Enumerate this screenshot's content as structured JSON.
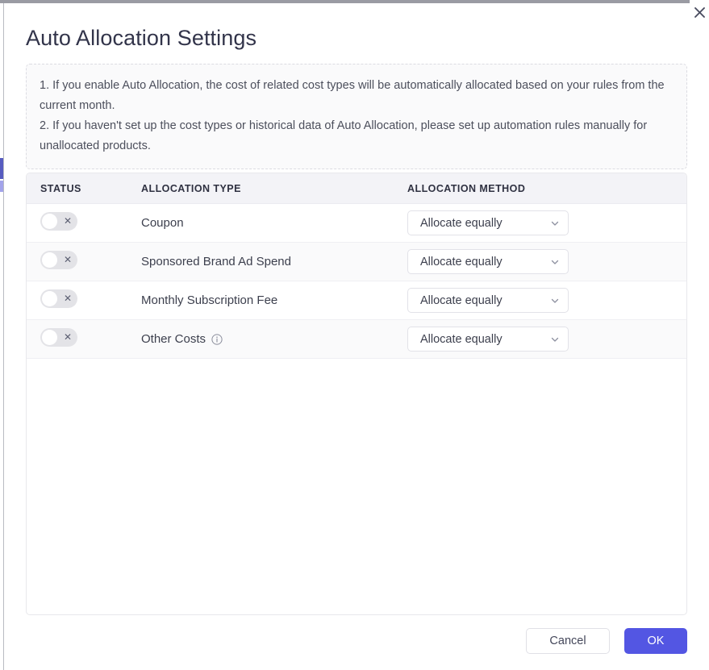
{
  "window": {
    "close_icon": "close-icon"
  },
  "dialog": {
    "title": "Auto Allocation Settings",
    "notice": {
      "line1": "1. If you enable Auto Allocation, the cost of related cost types will be automatically allocated based on your rules from the current month.",
      "line2": "2. If you haven't set up the cost types or historical data of Auto Allocation, please set up automation rules manually for unallocated products."
    },
    "table": {
      "columns": [
        {
          "key": "status",
          "label": "STATUS"
        },
        {
          "key": "type",
          "label": "ALLOCATION TYPE"
        },
        {
          "key": "method",
          "label": "ALLOCATION METHOD"
        }
      ],
      "rows": [
        {
          "status_toggle": {
            "state": "off",
            "mark": "✕"
          },
          "type": "Coupon",
          "has_info_icon": false,
          "method": "Allocate equally"
        },
        {
          "status_toggle": {
            "state": "off",
            "mark": "✕"
          },
          "type": "Sponsored Brand Ad Spend",
          "has_info_icon": false,
          "method": "Allocate equally"
        },
        {
          "status_toggle": {
            "state": "off",
            "mark": "✕"
          },
          "type": "Monthly Subscription Fee",
          "has_info_icon": false,
          "method": "Allocate equally"
        },
        {
          "status_toggle": {
            "state": "off",
            "mark": "✕"
          },
          "type": "Other Costs",
          "has_info_icon": true,
          "method": "Allocate equally"
        }
      ]
    },
    "footer": {
      "cancel_label": "Cancel",
      "ok_label": "OK"
    }
  },
  "colors": {
    "primary": "#5356e3",
    "title_text": "#32344a",
    "header_bg": "#f3f3f7",
    "notice_bg": "#fafafb",
    "toggle_off": "#e3e3e7"
  }
}
